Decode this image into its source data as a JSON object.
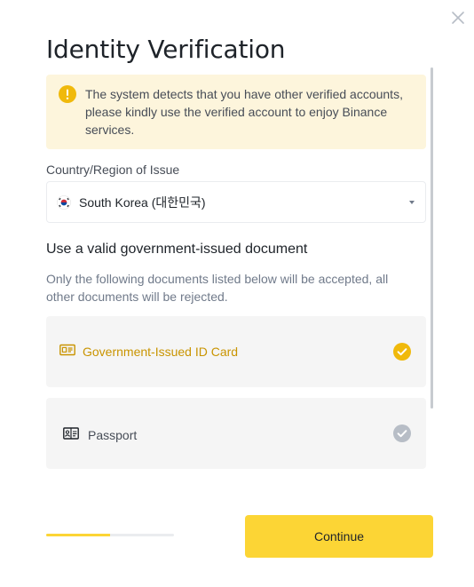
{
  "dialog": {
    "title": "Identity Verification"
  },
  "alert": {
    "icon": "exclamation-circle-icon",
    "text": "The system detects that you have other verified accounts, please kindly use the verified account to enjoy Binance services."
  },
  "country": {
    "label": "Country/Region of Issue",
    "value": "South Korea (대한민국)",
    "flag_icon": "south-korea-flag-icon"
  },
  "documents": {
    "heading": "Use a valid government-issued document",
    "description": "Only the following documents listed below will be accepted, all other documents will be rejected.",
    "options": [
      {
        "label": "Government-Issued ID Card",
        "icon": "id-card-icon",
        "selected": true
      },
      {
        "label": "Passport",
        "icon": "passport-icon",
        "selected": false
      }
    ]
  },
  "progress": {
    "value": 0.5
  },
  "footer": {
    "continue_label": "Continue"
  },
  "colors": {
    "accent": "#fcd535",
    "accent_text": "#c99400",
    "alert_bg": "#fdf5dc",
    "alert_icon": "#f0b90b",
    "unselected_check": "#b7bdc6"
  }
}
